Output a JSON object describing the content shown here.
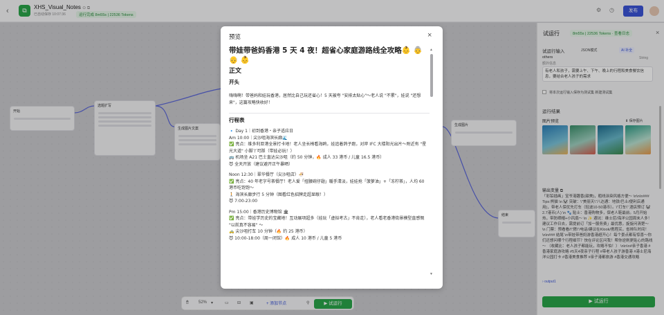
{
  "header": {
    "app_title": "XHS_Visual_Notes",
    "title_suffix_icons": "⊙ ⧉",
    "autosave_text": "已自动保存 10:07:36",
    "run_status": "运行完成 8m55s | 22536 Tokens",
    "publish_label": "发布"
  },
  "canvas": {
    "nodes": [
      {
        "label": "开始"
      },
      {
        "label": "选题扩写"
      },
      {
        "label": "生成图片文案"
      },
      {
        "label": "生成图片"
      },
      {
        "label": "结束"
      }
    ],
    "toolbar": {
      "zoom": "52%",
      "add_node": "添加节点",
      "run": "试运行"
    }
  },
  "panel": {
    "title": "试运行",
    "badge": "8m55s | 22536 Tokens · 查看日志",
    "input_label": "试运行输入",
    "json_mode": "JSON模式",
    "ai_fill": "AI 补全",
    "field_name": "others",
    "field_type": "String",
    "field_hint": "额外信息",
    "field_value": "有老人和孩子，需要上午、下午、晚上的行程和美食餐饮信息，要结合老人孩子的需求",
    "save_option": "将本次运行输入保存为测试集 新建测试集",
    "results_label": "运行结果",
    "image_preview_label": "图片预览",
    "save_images": "保存图片",
    "output_vars_label": "输出变量",
    "output_text": "「彩铅插画」宝爷港趣香(甜美)，粗线涂染风格方便～ \\n\\n\\n### Tips:熊猫 \\n 🐼 突破：\\\"美丽天\\\"八达通：地铁/巴士/便利店通用)，带老人保优先打车（轻波10-50港币）。\\\"打车\\\" 酒店预订 🐼 2.7港币(人) \\n 🐾 贴士：香港购物多，保老人鞋最前。5月开始热，带防晒帽+小风扇～ \\n ✨ 避坑：维士尼/海洋公园周末人多！建议工作日去，需提前订「加一服务费」最优惠，旋旋问清楚～ \\n 门票：预看看/\\\"燃\\\"/电话/建议在Klook/携程买，省排队时间！ \\n\\n### 结尾 \\n带娃带爸妈游香港超开心！每个景点都有惊喜～你们还想问哪个行程细节？快在评论区问我！帮你逆刷更贴心的路线～ （收藏比：老人孩子都能玩，攻略不怕！） \\n\\n\\n#亲子香港 #香港家庭游攻略 #5天4夜亲子行程 #带老人孩子游香港 #港士尼海洋公园打卡 #香港美食推荐 #亲子港都旅游 #香港交通攻略",
    "output_link": "output1",
    "run_button": "试运行"
  },
  "modal": {
    "title": "预览",
    "close_icon": "×",
    "heading": "带娃带爸妈香港 5 天 4 夜！超省心家庭游路线全攻略👶 👵 👴 👶",
    "section_body": "正文",
    "section_opening": "开头",
    "opening_text": "嗨嗨啊！带爸妈和娃玩香港，居然比自己玩还省心！5 天被夸 \"安排太贴心\"～老人说 \"不累\"，娃说 \"还想来\"，这篇攻略快收好！",
    "section_itinerary": "行程表",
    "day1": "🔹 Day 1｜初到香港・亲子适应日",
    "am": [
      "Am 10:00｜尖沙咀海滨长廊🌊",
      "✅ 亮点：维多利亚港全景打卡地！老人坐长椅看海鸥，娃追着鸽子跑，对岸 IFC 大楼阳光出片～附近有 \"星光大道\" 小脚丫可踩（带娃必玩！）",
      "🚌 机场坐 A21 巴士直达尖沙咀（约 50 分钟，🔥 成人 33 港币 / 儿童 16.5 港币）",
      "😈 全天开放（建议避开正午暴晒）"
    ],
    "noon": [
      "Noon 12:30｜翠华餐厅（尖沙咀店）🍜",
      "✅ 亮点：40 年老字号茶餐厅！老人爱「扭腰碗仔翅」暖手清淡，娃娃抢「菠萝油」+「冻柠茶」，人均 60 港币吃饱饱～",
      "🚶 海滨长廊步行 5 分钟（图看红色招牌走超显眼！）",
      "😈 7:00-23:00"
    ],
    "pm": [
      "Pm 15:00｜香港历史博物馆 🏛",
      "✅ 亮点：带娃学历史的宝藏地！互动展项超多（娃玩「虚拟考古」不肯走），老人看老香港街景模型直感慨 \"以前真不容易\" ～",
      "🚕 尖沙咀打车 10 分钟（🔥 约 25 港币）",
      "😈 10:00-18:00（周一闭馆）🔥 成人 10 港币 / 儿童 5 港币"
    ]
  }
}
